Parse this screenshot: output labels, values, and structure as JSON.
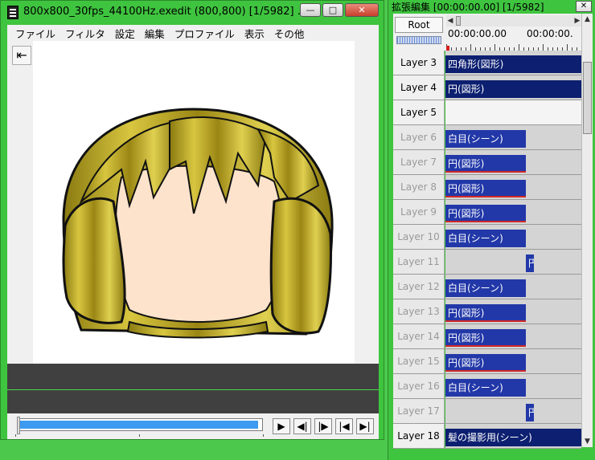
{
  "left_window": {
    "title": "800x800_30fps_44100Hz.exedit (800,800)  [1/5982]  ...",
    "menu": [
      "ファイル",
      "フィルタ",
      "設定",
      "編集",
      "プロファイル",
      "表示",
      "その他"
    ],
    "controls": {
      "minimize": "—",
      "maximize": "□",
      "close": "✕"
    }
  },
  "preview": {
    "back_icon": "⇤",
    "colors": {
      "hair": "#b8a420",
      "face": "#fde3cc",
      "outline": "#111111"
    }
  },
  "playback": {
    "progress": 0.99,
    "buttons": [
      "▶",
      "◀|",
      "|▶",
      "|◀",
      "▶|"
    ]
  },
  "right_window": {
    "title": "拡張編集 [00:00:00.00] [1/5982]",
    "close_label": "✕",
    "root_label": "Root",
    "time_labels": [
      "00:00:00.00",
      "00:00:00."
    ],
    "layers": [
      {
        "label": "Layer  3",
        "state": "normal",
        "clips": [
          {
            "text": "四角形(図形)",
            "style": "navy",
            "start": 0,
            "end": 1
          }
        ]
      },
      {
        "label": "Layer  4",
        "state": "normal",
        "clips": [
          {
            "text": "円(図形)",
            "style": "navy",
            "start": 0,
            "end": 1
          }
        ]
      },
      {
        "label": "Layer  5",
        "state": "active",
        "clips": []
      },
      {
        "label": "Layer  6",
        "state": "hidden",
        "clips": [
          {
            "text": "白目(シーン)",
            "style": "blue",
            "start": 0,
            "end": 0.59
          }
        ]
      },
      {
        "label": "Layer  7",
        "state": "hidden",
        "clips": [
          {
            "text": "円(図形)",
            "style": "blue",
            "start": 0,
            "end": 0.59,
            "redline": true
          }
        ]
      },
      {
        "label": "Layer  8",
        "state": "hidden",
        "clips": [
          {
            "text": "円(図形)",
            "style": "blue",
            "start": 0,
            "end": 0.59,
            "redline": true
          }
        ]
      },
      {
        "label": "Layer  9",
        "state": "hidden",
        "clips": [
          {
            "text": "円(図形)",
            "style": "blue",
            "start": 0,
            "end": 0.59,
            "redline": true
          }
        ]
      },
      {
        "label": "Layer 10",
        "state": "hidden",
        "clips": [
          {
            "text": "白目(シーン)",
            "style": "blue",
            "start": 0,
            "end": 0.59
          }
        ]
      },
      {
        "label": "Layer 11",
        "state": "hidden",
        "clips": [
          {
            "text": "円",
            "style": "blue",
            "start": 0.59,
            "end": 0.65
          }
        ]
      },
      {
        "label": "Layer 12",
        "state": "hidden",
        "clips": [
          {
            "text": "白目(シーン)",
            "style": "blue",
            "start": 0,
            "end": 0.59
          }
        ]
      },
      {
        "label": "Layer 13",
        "state": "hidden",
        "clips": [
          {
            "text": "円(図形)",
            "style": "blue",
            "start": 0,
            "end": 0.59,
            "redline": true
          }
        ]
      },
      {
        "label": "Layer 14",
        "state": "hidden",
        "clips": [
          {
            "text": "円(図形)",
            "style": "blue",
            "start": 0,
            "end": 0.59,
            "redline": true
          }
        ]
      },
      {
        "label": "Layer 15",
        "state": "hidden",
        "clips": [
          {
            "text": "円(図形)",
            "style": "blue",
            "start": 0,
            "end": 0.59,
            "redline": true
          }
        ]
      },
      {
        "label": "Layer 16",
        "state": "hidden",
        "clips": [
          {
            "text": "白目(シーン)",
            "style": "blue",
            "start": 0,
            "end": 0.59
          }
        ]
      },
      {
        "label": "Layer 17",
        "state": "hidden",
        "clips": [
          {
            "text": "円",
            "style": "blue",
            "start": 0.59,
            "end": 0.65
          }
        ]
      },
      {
        "label": "Layer 18",
        "state": "normal",
        "clips": [
          {
            "text": "髪の撮影用(シーン)",
            "style": "navy",
            "start": 0,
            "end": 1
          }
        ]
      }
    ]
  }
}
